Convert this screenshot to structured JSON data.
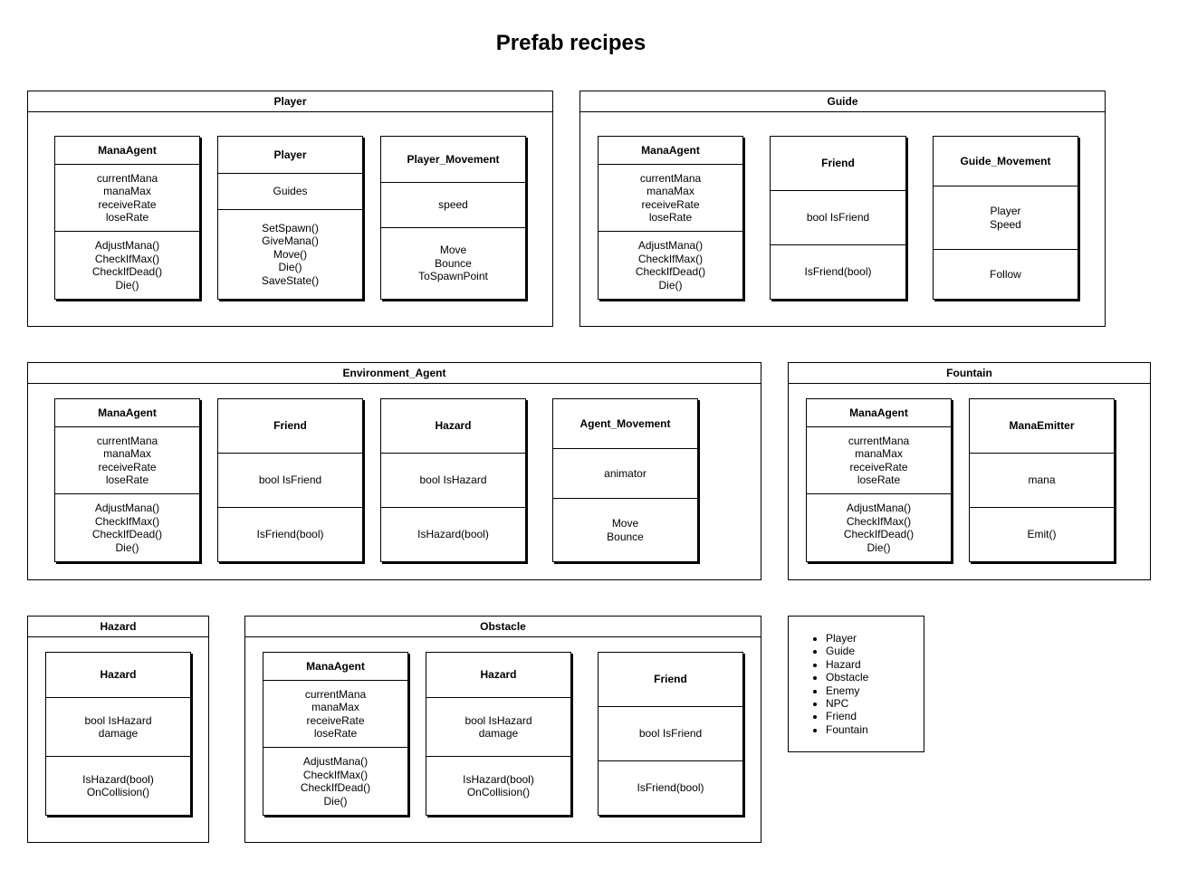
{
  "title": "Prefab recipes",
  "groups": {
    "player": {
      "title": "Player",
      "classes": [
        {
          "name": "ManaAgent",
          "attributes": "currentMana\nmanaMax\nreceiveRate\nloseRate",
          "methods": "AdjustMana()\nCheckIfMax()\nCheckIfDead()\nDie()"
        },
        {
          "name": "Player",
          "attributes": "Guides",
          "methods": "SetSpawn()\nGiveMana()\nMove()\nDie()\nSaveState()"
        },
        {
          "name": "Player_Movement",
          "attributes": "speed",
          "methods": "Move\nBounce\nToSpawnPoint"
        }
      ]
    },
    "guide": {
      "title": "Guide",
      "classes": [
        {
          "name": "ManaAgent",
          "attributes": "currentMana\nmanaMax\nreceiveRate\nloseRate",
          "methods": "AdjustMana()\nCheckIfMax()\nCheckIfDead()\nDie()"
        },
        {
          "name": "Friend",
          "attributes": "bool IsFriend",
          "methods": "IsFriend(bool)"
        },
        {
          "name": "Guide_Movement",
          "attributes": "Player\nSpeed",
          "methods": "Follow"
        }
      ]
    },
    "environment_agent": {
      "title": "Environment_Agent",
      "classes": [
        {
          "name": "ManaAgent",
          "attributes": "currentMana\nmanaMax\nreceiveRate\nloseRate",
          "methods": "AdjustMana()\nCheckIfMax()\nCheckIfDead()\nDie()"
        },
        {
          "name": "Friend",
          "attributes": "bool IsFriend",
          "methods": "IsFriend(bool)"
        },
        {
          "name": "Hazard",
          "attributes": "bool IsHazard",
          "methods": "IsHazard(bool)"
        },
        {
          "name": "Agent_Movement",
          "attributes": "animator",
          "methods": "Move\nBounce"
        }
      ]
    },
    "fountain": {
      "title": "Fountain",
      "classes": [
        {
          "name": "ManaAgent",
          "attributes": "currentMana\nmanaMax\nreceiveRate\nloseRate",
          "methods": "AdjustMana()\nCheckIfMax()\nCheckIfDead()\nDie()"
        },
        {
          "name": "ManaEmitter",
          "attributes": "mana",
          "methods": "Emit()"
        }
      ]
    },
    "hazard": {
      "title": "Hazard",
      "classes": [
        {
          "name": "Hazard",
          "attributes": "bool IsHazard\ndamage",
          "methods": "IsHazard(bool)\nOnCollision()"
        }
      ]
    },
    "obstacle": {
      "title": "Obstacle",
      "classes": [
        {
          "name": "ManaAgent",
          "attributes": "currentMana\nmanaMax\nreceiveRate\nloseRate",
          "methods": "AdjustMana()\nCheckIfMax()\nCheckIfDead()\nDie()"
        },
        {
          "name": "Hazard",
          "attributes": "bool IsHazard\ndamage",
          "methods": "IsHazard(bool)\nOnCollision()"
        },
        {
          "name": "Friend",
          "attributes": "bool IsFriend",
          "methods": "IsFriend(bool)"
        }
      ]
    }
  },
  "legend": {
    "items": [
      "Player",
      "Guide",
      "Hazard",
      "Obstacle",
      "Enemy",
      "NPC",
      "Friend",
      "Fountain"
    ]
  }
}
